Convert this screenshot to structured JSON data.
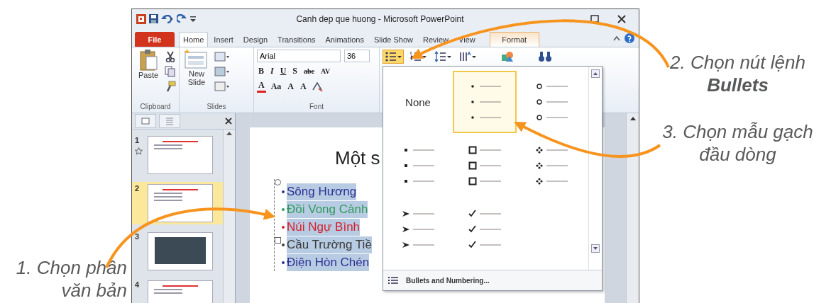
{
  "window": {
    "title": "Canh dep que huong - Microsoft PowerPoint"
  },
  "ribbon_tabs": [
    {
      "label": "File",
      "kind": "file",
      "selected": false
    },
    {
      "label": "Home",
      "kind": "tab",
      "selected": true
    },
    {
      "label": "Insert",
      "kind": "tab",
      "selected": false
    },
    {
      "label": "Design",
      "kind": "tab",
      "selected": false
    },
    {
      "label": "Transitions",
      "kind": "tab",
      "selected": false
    },
    {
      "label": "Animations",
      "kind": "tab",
      "selected": false
    },
    {
      "label": "Slide Show",
      "kind": "tab",
      "selected": false
    },
    {
      "label": "Review",
      "kind": "tab",
      "selected": false
    },
    {
      "label": "View",
      "kind": "tab",
      "selected": false
    },
    {
      "label": "Format",
      "kind": "contextual",
      "selected": false
    }
  ],
  "ribbon": {
    "groups": [
      {
        "kind": "clipboard",
        "label": "Clipboard",
        "big_button": "Paste"
      },
      {
        "kind": "slides",
        "label": "Slides",
        "big_button": "New Slide"
      },
      {
        "kind": "font",
        "label": "Font",
        "font_name": "Arial",
        "font_size": "36",
        "format_buttons": [
          "B",
          "I",
          "U",
          "S",
          "abc",
          "AV"
        ],
        "size_buttons": [
          "A",
          "Aa",
          "A",
          "A"
        ]
      },
      {
        "kind": "paragraph",
        "buttons": [
          {
            "kind": "bullets",
            "selected": true
          },
          {
            "kind": "numbering",
            "selected": false
          },
          {
            "kind": "line_spacing",
            "selected": false
          },
          {
            "kind": "columns",
            "selected": false
          }
        ]
      }
    ]
  },
  "slides_panel": {
    "slides": [
      {
        "number": "1",
        "kind": "title",
        "transition": true,
        "selected": false
      },
      {
        "number": "2",
        "kind": "list",
        "transition": false,
        "selected": true
      },
      {
        "number": "3",
        "kind": "photo",
        "transition": false,
        "selected": false
      },
      {
        "number": "4",
        "kind": "title",
        "transition": false,
        "selected": false
      }
    ]
  },
  "slide": {
    "title": "Một s",
    "bullets": [
      {
        "text": "Sông Hương",
        "color": "#2e3192"
      },
      {
        "text": "Đồi Vong Cảnh",
        "color": "#2f9a5a"
      },
      {
        "text": "Núi Ngự Bình",
        "color": "#d4202a"
      },
      {
        "text": "Cầu Trường Tiề",
        "color": "#3a3a3a"
      },
      {
        "text": "Điện Hòn Chén",
        "color": "#2e3192"
      }
    ]
  },
  "bullets_gallery": {
    "items": [
      {
        "kind": "none",
        "label": "None",
        "selected": false
      },
      {
        "kind": "dot",
        "selected": true
      },
      {
        "kind": "circle",
        "selected": false
      },
      {
        "kind": "square",
        "selected": false
      },
      {
        "kind": "hollow_square",
        "selected": false
      },
      {
        "kind": "diamond",
        "selected": false
      },
      {
        "kind": "arrowhead",
        "selected": false
      },
      {
        "kind": "check",
        "selected": false
      }
    ],
    "footer": "Bullets and Numbering..."
  },
  "annotations": [
    {
      "kind": "left",
      "text": "1. Chọn phần\nvăn bản"
    },
    {
      "kind": "right",
      "text": "2. Chọn nút lệnh\n**Bullets**"
    },
    {
      "kind": "right",
      "text": "3. Chọn mẫu gạch\nđầu dòng"
    }
  ]
}
